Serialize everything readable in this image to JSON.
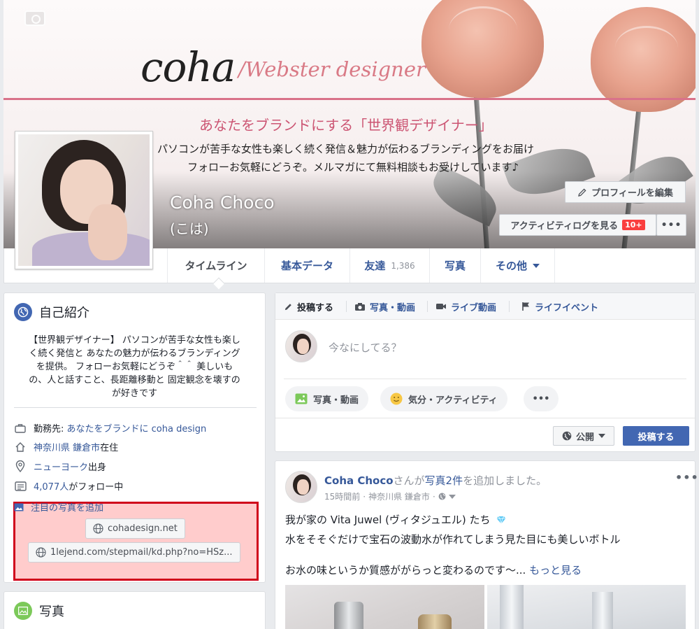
{
  "cover": {
    "brand": "coha",
    "brand_sub": "/Webster designer",
    "tagline": "あなたをブランドにする「世界観デザイナー」",
    "subline1": "パソコンが苦手な女性も楽しく続く発信＆魅力が伝わるブランディングをお届け",
    "subline2": "フォローお気軽にどうぞ。メルマガにて無料相談もお受けしています♪"
  },
  "profile": {
    "name": "Coha Choco",
    "alternate_name": "(こは)",
    "edit_profile_label": "プロフィールを編集",
    "activity_log_label": "アクティビティログを見る",
    "activity_badge": "10+",
    "more_label": "•••"
  },
  "nav": {
    "timeline": "タイムライン",
    "about": "基本データ",
    "friends": "友達",
    "friends_count": "1,386",
    "photos": "写真",
    "more": "その他"
  },
  "intro": {
    "title": "自己紹介",
    "bio_lines": [
      "【世界観デザイナー】 パソコンが苦手な女性も楽し",
      "く続く発信と あなたの魅力が伝わるブランディング",
      "を提供。 フォローお気軽にどうぞ＾＾ 美しいも",
      "の、人と話すこと、長距離移動と 固定観念を壊すの",
      "が好きです"
    ],
    "work_prefix": "勤務先: ",
    "work_link": "あなたをブランドに coha design",
    "lives_link": "神奈川県 鎌倉市",
    "lives_suffix": "在住",
    "from_link": "ニューヨーク",
    "from_suffix": "出身",
    "followers_link": "4,077人",
    "followers_suffix": "がフォロー中",
    "add_featured": "注目の写真を追加",
    "website": "cohadesign.net",
    "link2": "1lejend.com/stepmail/kd.php?no=HSz..."
  },
  "photos_card": {
    "title": "写真"
  },
  "composer": {
    "tab_post": "投稿する",
    "tab_photo": "写真・動画",
    "tab_live": "ライブ動画",
    "tab_event": "ライフイベント",
    "placeholder": "今なにしてる？",
    "photo_video": "写真・動画",
    "feeling": "気分・アクティビティ",
    "more": "•••",
    "privacy": "公開",
    "post_button": "投稿する"
  },
  "post": {
    "author": "Coha Choco",
    "action_pre": "さんが",
    "action_link": "写真2件",
    "action_post": "を追加しました。",
    "time": "15時間前",
    "location": "神奈川県 鎌倉市",
    "line1": "我が家の Vita Juwel (ヴィタジュエル) たち",
    "line2": "水をそそぐだけで宝石の波動水が作れてしまう見た目にも美しいボトル",
    "line3": "お水の味というか質感ががらっと変わるのです〜...",
    "see_more": "もっと見る",
    "more_menu": "•••"
  },
  "colors": {
    "link": "#365899",
    "primary_button": "#4267b2",
    "highlight_border": "#d0021b",
    "badge": "#fa3e3e",
    "background": "#e9ebee"
  }
}
